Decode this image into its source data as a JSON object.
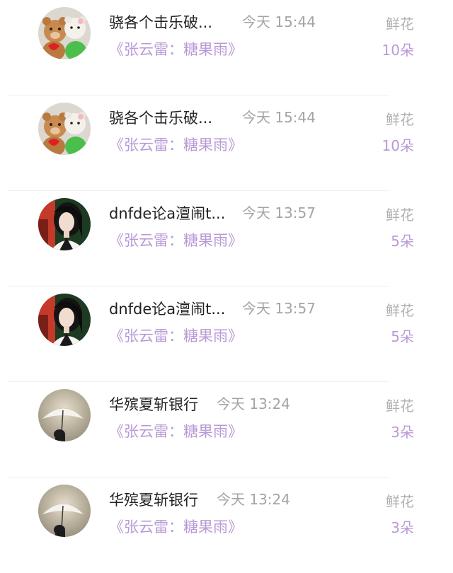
{
  "messages": [
    {
      "username": "骁各个击乐破...",
      "time": "今天 15:44",
      "gift_text": "《张云雷：糖果雨》",
      "flower_label": "鲜花",
      "flower_count": "10朵",
      "avatar": "teddy-bears"
    },
    {
      "username": "骁各个击乐破...",
      "time": "今天 15:44",
      "gift_text": "《张云雷：糖果雨》",
      "flower_label": "鲜花",
      "flower_count": "10朵",
      "avatar": "teddy-bears"
    },
    {
      "username": "dnfde论a澶闹t...",
      "time": "今天 13:57",
      "gift_text": "《张云雷：糖果雨》",
      "flower_label": "鲜花",
      "flower_count": "5朵",
      "avatar": "girl-portrait"
    },
    {
      "username": "dnfde论a澶闹t...",
      "time": "今天 13:57",
      "gift_text": "《张云雷：糖果雨》",
      "flower_label": "鲜花",
      "flower_count": "5朵",
      "avatar": "girl-portrait"
    },
    {
      "username": "华殡夏斩银行",
      "time": "今天 13:24",
      "gift_text": "《张云雷：糖果雨》",
      "flower_label": "鲜花",
      "flower_count": "3朵",
      "avatar": "umbrella-silhouette"
    },
    {
      "username": "华殡夏斩银行",
      "time": "今天 13:24",
      "gift_text": "《张云雷：糖果雨》",
      "flower_label": "鲜花",
      "flower_count": "3朵",
      "avatar": "umbrella-silhouette"
    }
  ]
}
